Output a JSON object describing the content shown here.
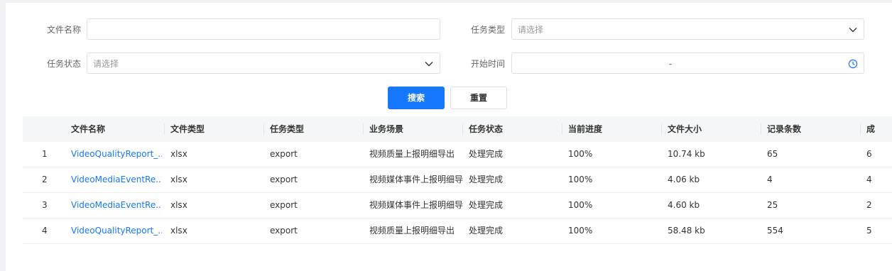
{
  "filters": {
    "file_name_label": "文件名称",
    "file_name_value": "",
    "task_type_label": "任务类型",
    "task_type_placeholder": "请选择",
    "task_status_label": "任务状态",
    "task_status_placeholder": "请选择",
    "start_time_label": "开始时间",
    "start_time_separator": "-"
  },
  "buttons": {
    "search": "搜索",
    "reset": "重置"
  },
  "table": {
    "columns": [
      "",
      "文件名称",
      "文件类型",
      "任务类型",
      "业务场景",
      "任务状态",
      "当前进度",
      "文件大小",
      "记录条数",
      "成"
    ],
    "rows": [
      {
        "index": "1",
        "file_name": "VideoQualityReport_...",
        "file_type": "xlsx",
        "task_type": "export",
        "scene": "视频质量上报明细导出",
        "status": "处理完成",
        "progress": "100%",
        "size": "10.74 kb",
        "records": "65",
        "extra": "6"
      },
      {
        "index": "2",
        "file_name": "VideoMediaEventRe...",
        "file_type": "xlsx",
        "task_type": "export",
        "scene": "视频媒体事件上报明细导",
        "status": "处理完成",
        "progress": "100%",
        "size": "4.06 kb",
        "records": "4",
        "extra": "4"
      },
      {
        "index": "3",
        "file_name": "VideoMediaEventRe...",
        "file_type": "xlsx",
        "task_type": "export",
        "scene": "视频媒体事件上报明细导",
        "status": "处理完成",
        "progress": "100%",
        "size": "4.60 kb",
        "records": "25",
        "extra": "2"
      },
      {
        "index": "4",
        "file_name": "VideoQualityReport_...",
        "file_type": "xlsx",
        "task_type": "export",
        "scene": "视频质量上报明细导出",
        "status": "处理完成",
        "progress": "100%",
        "size": "58.48 kb",
        "records": "554",
        "extra": "5"
      }
    ]
  },
  "colors": {
    "primary": "#1677ff",
    "header_bg": "#f5f6f7",
    "page_bg": "#f0f2f5"
  },
  "icons": {
    "select_arrow": "chevron-down-icon",
    "time_picker": "clock-icon"
  }
}
